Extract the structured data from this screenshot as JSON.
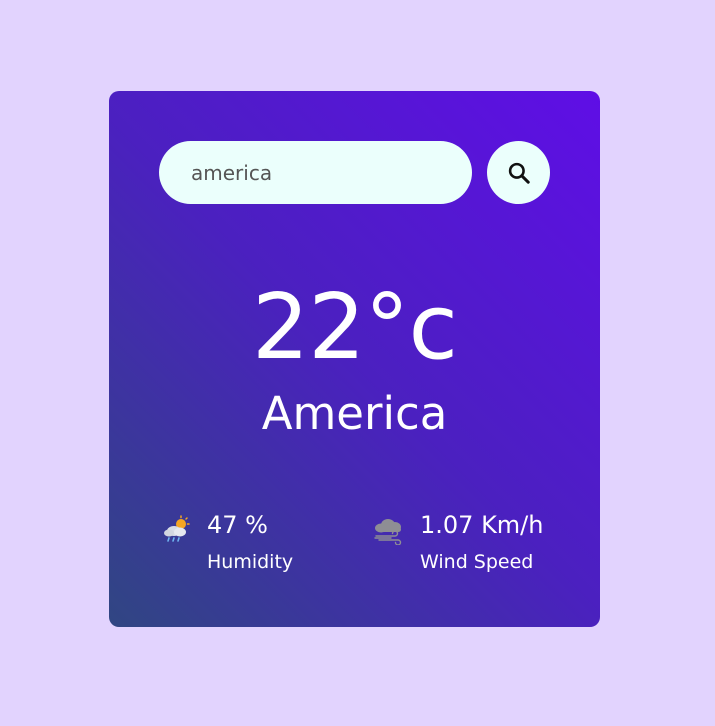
{
  "search": {
    "value": "america",
    "placeholder": "",
    "button_icon": "search-icon"
  },
  "weather": {
    "temperature": "22°c",
    "city": "America"
  },
  "details": {
    "humidity": {
      "icon": "rain-cloud-sun-icon",
      "value": "47 %",
      "label": "Humidity"
    },
    "wind": {
      "icon": "wind-cloud-icon",
      "value": "1.07 Km/h",
      "label": "Wind Speed"
    }
  },
  "colors": {
    "background": "#e2d3fe",
    "card_gradient_start": "#5f0ee6",
    "card_gradient_end": "#304682",
    "input_background": "#ebfffc"
  }
}
